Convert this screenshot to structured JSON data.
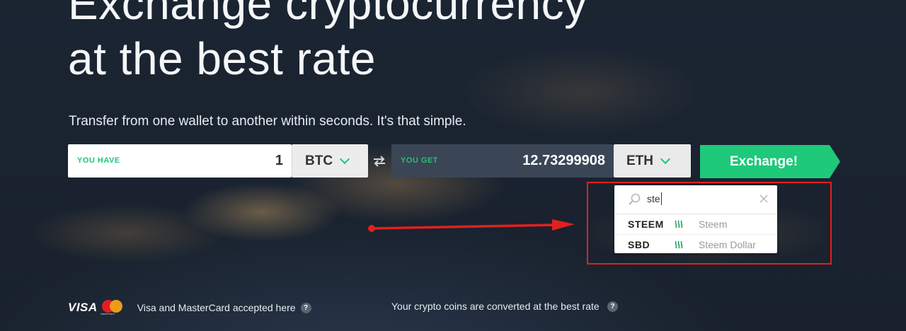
{
  "hero": {
    "title_line1": "Exchange cryptocurrency",
    "title_line2_light": "at the ",
    "title_line2_bold": "best rate"
  },
  "subtitle": "Transfer from one wallet to another within seconds. It's that simple.",
  "exchange_form": {
    "have_label": "YOU HAVE",
    "have_amount": "1",
    "have_coin": "BTC",
    "get_label": "YOU GET",
    "get_amount": "12.73299908",
    "get_coin": "ETH",
    "submit_label": "Exchange!"
  },
  "coin_dropdown": {
    "search_value": "ste",
    "results": [
      {
        "ticker": "STEEM",
        "name": "Steem",
        "icon": "steem-icon"
      },
      {
        "ticker": "SBD",
        "name": "Steem Dollar",
        "icon": "steem-icon"
      }
    ]
  },
  "footer": {
    "visa_label": "VISA",
    "mastercard_label": "mastercard",
    "cards_text": "Visa and MasterCard accepted here",
    "rate_text": "Your crypto coins are converted at the best rate",
    "help_glyph": "?"
  },
  "colors": {
    "accent_green": "#1ec97a",
    "annotation_red": "#e2201f",
    "background": "#1b2532"
  }
}
